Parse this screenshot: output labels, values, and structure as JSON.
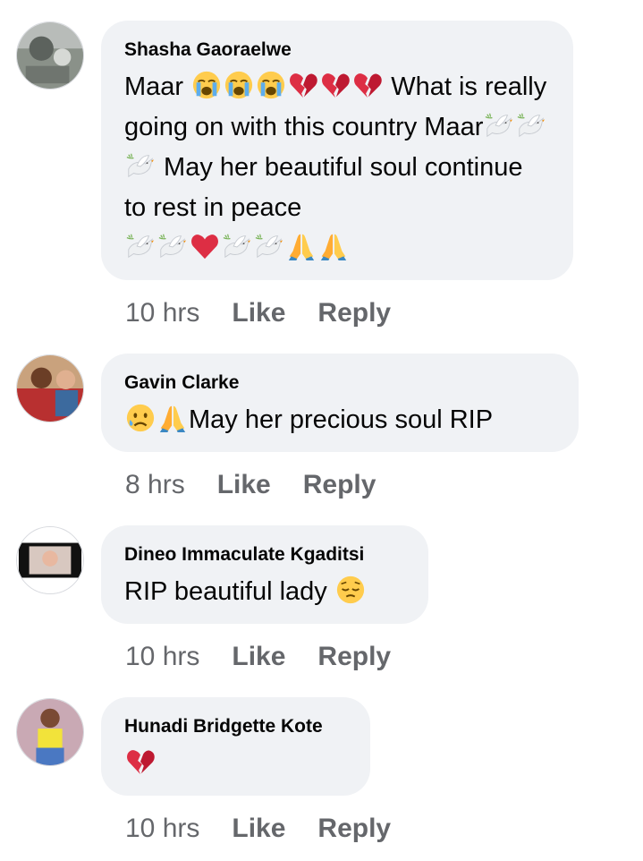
{
  "comments": [
    {
      "author": "Shasha Gaoraelwe",
      "text_parts": [
        "Maar ",
        " What is really going on with this country Maar",
        " May her beautiful soul continue to rest in peace"
      ],
      "time": "10 hrs",
      "like_label": "Like",
      "reply_label": "Reply",
      "emojis": [
        "crying-face",
        "crying-face",
        "crying-face",
        "broken-heart",
        "broken-heart",
        "broken-heart",
        "dove",
        "dove",
        "dove",
        "dove",
        "dove",
        "red-heart",
        "dove",
        "dove",
        "folded-hands",
        "folded-hands"
      ]
    },
    {
      "author": "Gavin Clarke",
      "text_parts": [
        "May her precious soul RIP"
      ],
      "time": "8 hrs",
      "like_label": "Like",
      "reply_label": "Reply",
      "emojis": [
        "sad-tear-face",
        "folded-hands"
      ]
    },
    {
      "author": "Dineo Immaculate Kgaditsi",
      "text_parts": [
        "RIP beautiful lady "
      ],
      "time": "10 hrs",
      "like_label": "Like",
      "reply_label": "Reply",
      "emojis": [
        "pensive-face"
      ]
    },
    {
      "author": "Hunadi Bridgette Kote",
      "text_parts": [],
      "time": "10 hrs",
      "like_label": "Like",
      "reply_label": "Reply",
      "emojis": [
        "broken-heart"
      ]
    }
  ],
  "colors": {
    "bubble": "#f0f2f5",
    "meta_text": "#65676b",
    "body_text": "#050505"
  }
}
